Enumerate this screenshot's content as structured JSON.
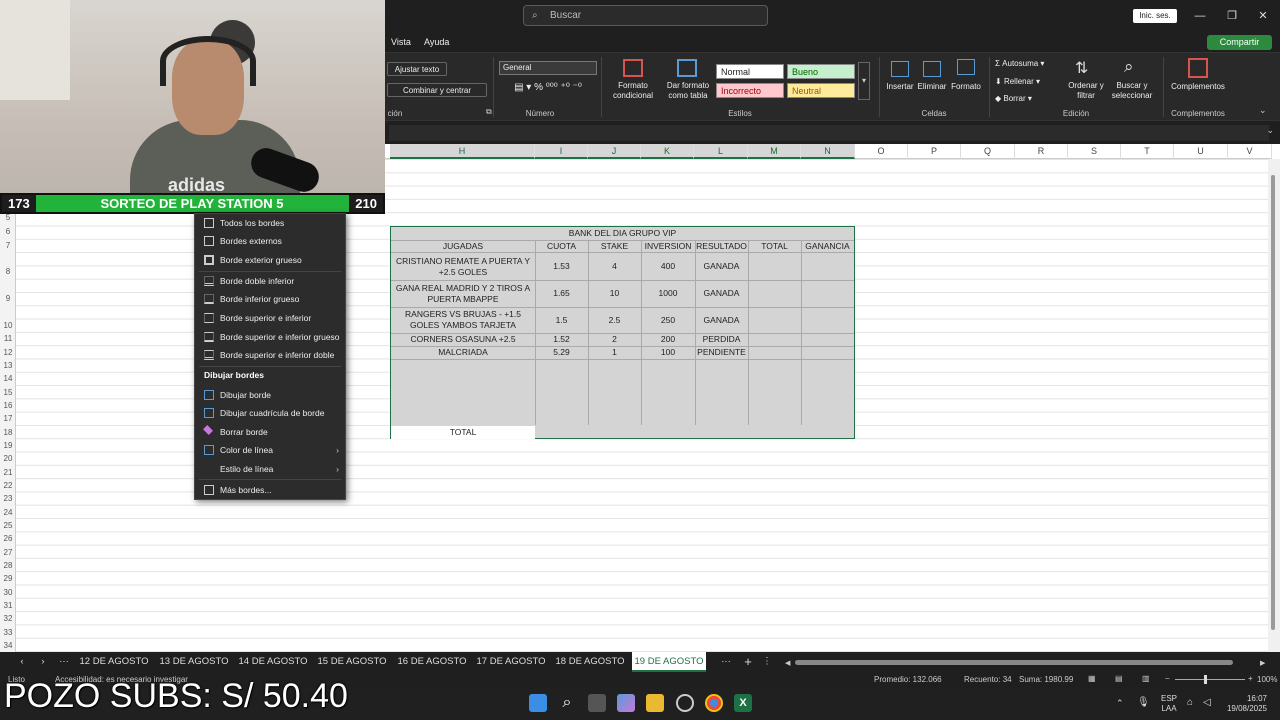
{
  "title_bar": {
    "search_placeholder": "Buscar",
    "signin_label": "Inic. ses."
  },
  "menu": {
    "items": [
      "Vista",
      "Ayuda"
    ],
    "share_label": "Compartir"
  },
  "ribbon": {
    "wrap_text": "Ajustar texto",
    "merge_center": "Combinar y centrar",
    "alignment_group": "ción",
    "number_format": "General",
    "number_group": "Número",
    "cond_format": "Formato condicional",
    "format_table": "Dar formato como tabla",
    "styles": {
      "normal": "Normal",
      "good": "Bueno",
      "bad": "Incorrecto",
      "neutral": "Neutral"
    },
    "styles_group": "Estilos",
    "insert": "Insertar",
    "delete": "Eliminar",
    "format": "Formato",
    "cells_group": "Celdas",
    "autosum": "Autosuma",
    "fill": "Rellenar",
    "clear": "Borrar",
    "sort_filter": "Ordenar y filtrar",
    "find_select": "Buscar y seleccionar",
    "editing_group": "Edición",
    "addins": "Complementos",
    "addins_group": "Complementos"
  },
  "columns": [
    "H",
    "I",
    "J",
    "K",
    "L",
    "M",
    "N",
    "O",
    "P",
    "Q",
    "R",
    "S",
    "T",
    "U",
    "V"
  ],
  "rows": [
    "5",
    "6",
    "7",
    "8",
    "9",
    "10",
    "11",
    "12",
    "13",
    "14",
    "15",
    "16",
    "17",
    "18",
    "19",
    "20",
    "21",
    "22",
    "23",
    "24",
    "25",
    "26",
    "27",
    "28",
    "29",
    "30",
    "31",
    "32",
    "33",
    "34"
  ],
  "table": {
    "title": "BANK DEL DIA GRUPO VIP",
    "headers": [
      "JUGADAS",
      "CUOTA",
      "STAKE",
      "INVERSION",
      "RESULTADO",
      "TOTAL",
      "GANANCIA"
    ],
    "rows": [
      [
        "CRISTIANO REMATE A PUERTA Y +2.5 GOLES",
        "1.53",
        "4",
        "400",
        "GANADA",
        "",
        ""
      ],
      [
        "GANA REAL MADRID Y 2 TIROS A PUERTA MBAPPE",
        "1.65",
        "10",
        "1000",
        "GANADA",
        "",
        ""
      ],
      [
        "RANGERS VS BRUJAS - +1.5 GOLES YAMBOS TARJETA",
        "1.5",
        "2.5",
        "250",
        "GANADA",
        "",
        ""
      ],
      [
        "CORNERS OSASUNA +2.5",
        "1.52",
        "2",
        "200",
        "PERDIDA",
        "",
        ""
      ],
      [
        "MALCRIADA",
        "5.29",
        "1",
        "100",
        "PENDIENTE",
        "",
        ""
      ]
    ],
    "total_label": "TOTAL"
  },
  "context_menu": {
    "items": [
      "Todos los bordes",
      "Bordes externos",
      "Borde exterior grueso",
      "Borde doble inferior",
      "Borde inferior grueso",
      "Borde superior e inferior",
      "Borde superior e inferior grueso",
      "Borde superior e inferior doble"
    ],
    "draw_header": "Dibujar bordes",
    "draw_items": [
      "Dibujar borde",
      "Dibujar cuadrícula de borde",
      "Borrar borde",
      "Color de línea",
      "Estilo de línea",
      "Más bordes..."
    ]
  },
  "stream_overlay": {
    "left_count": "173",
    "banner_text": "SORTEO DE PLAY STATION 5",
    "right_count": "210",
    "pozo_text": "POZO SUBS: S/ 50.40"
  },
  "sheet_tabs": [
    "12 DE AGOSTO",
    "13 DE AGOSTO",
    "14 DE AGOSTO",
    "15 DE AGOSTO",
    "16 DE AGOSTO",
    "17 DE AGOSTO",
    "18 DE AGOSTO",
    "19 DE AGOSTO"
  ],
  "active_tab": "19 DE AGOSTO",
  "status": {
    "ready": "Listo",
    "accessibility": "Accesibilidad: es necesario investigar",
    "average": "Promedio: 132.066",
    "count": "Recuento: 34",
    "sum": "Suma: 1980.99",
    "zoom": "100%"
  },
  "taskbar": {
    "lang1": "ESP",
    "lang2": "LAA",
    "time": "16:07",
    "date": "19/08/2025"
  },
  "colors": {
    "excel_green": "#1e7145",
    "banner_green": "#22b33a",
    "good_bg": "#c6efce",
    "bad_bg": "#ffc7ce",
    "neutral_bg": "#ffeb9c"
  }
}
